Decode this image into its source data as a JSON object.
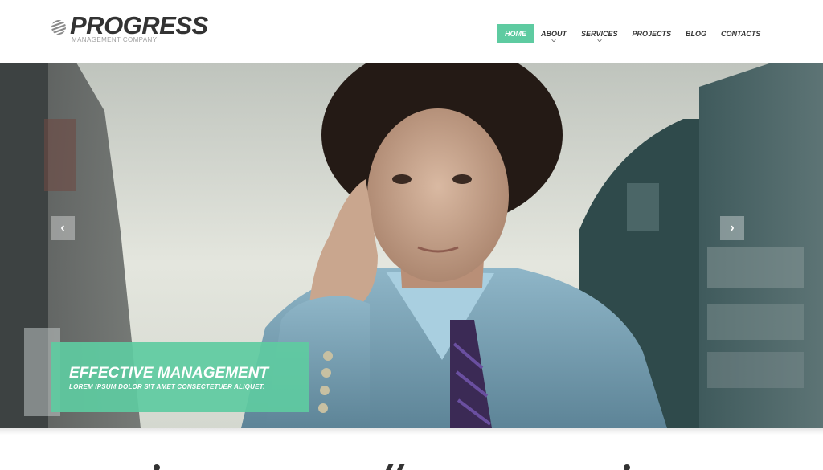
{
  "brand": {
    "name": "PROGRESS",
    "tagline": "MANAGEMENT COMPANY",
    "logo_icon": "striped-sphere-icon"
  },
  "nav": {
    "items": [
      {
        "label": "HOME",
        "active": true,
        "has_submenu": false
      },
      {
        "label": "ABOUT",
        "active": false,
        "has_submenu": true
      },
      {
        "label": "SERVICES",
        "active": false,
        "has_submenu": true
      },
      {
        "label": "PROJECTS",
        "active": false,
        "has_submenu": false
      },
      {
        "label": "BLOG",
        "active": false,
        "has_submenu": false
      },
      {
        "label": "CONTACTS",
        "active": false,
        "has_submenu": false
      }
    ]
  },
  "slider": {
    "prev_icon": "‹",
    "next_icon": "›",
    "caption_title": "EFFECTIVE MANAGEMENT",
    "caption_text": "LOREM IPSUM DOLOR SIT AMET CONSECTETUER ALIQUET."
  },
  "colors": {
    "accent": "#5ecba1",
    "text_dark": "#333333",
    "text_muted": "#a0a0a0"
  }
}
